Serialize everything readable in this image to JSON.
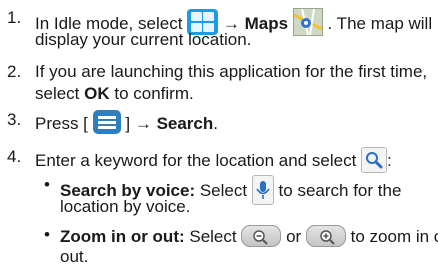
{
  "steps": [
    {
      "number": "1.",
      "line1_a": "In Idle mode, select ",
      "line1_arrow": "→",
      "line1_bold": "Maps",
      "line1_b": ". The map will",
      "line2": "display your current location."
    },
    {
      "number": "2.",
      "line1": "If you are launching this application for the first time,",
      "line2_a": "select ",
      "line2_bold": "OK",
      "line2_b": " to confirm."
    },
    {
      "number": "3.",
      "a": "Press [",
      "b": "] ",
      "arrow": "→",
      "bold": "Search",
      "end": "."
    },
    {
      "number": "4.",
      "a": "Enter a keyword for the location and select ",
      "end": ":",
      "bullets": [
        {
          "marker": "•",
          "bold": "Search by voice:",
          "a": " Select ",
          "b": " to search for the",
          "line2": "location by voice."
        },
        {
          "marker": "•",
          "bold": "Zoom in or out:",
          "a": " Select ",
          "mid": " or ",
          "b": " to zoom in or",
          "line2": "out."
        }
      ]
    }
  ],
  "icons": {
    "apps": "grid-icon",
    "maps": "maps-icon",
    "menu": "menu-key-icon",
    "search": "magnifier-icon",
    "voice": "microphone-icon",
    "zoom_out": "zoom-out-icon",
    "zoom_in": "zoom-in-icon"
  },
  "colors": {
    "text": "#1a1a1a",
    "apps_icon": "#1e9be6",
    "menu_icon": "#2e7fc0"
  }
}
